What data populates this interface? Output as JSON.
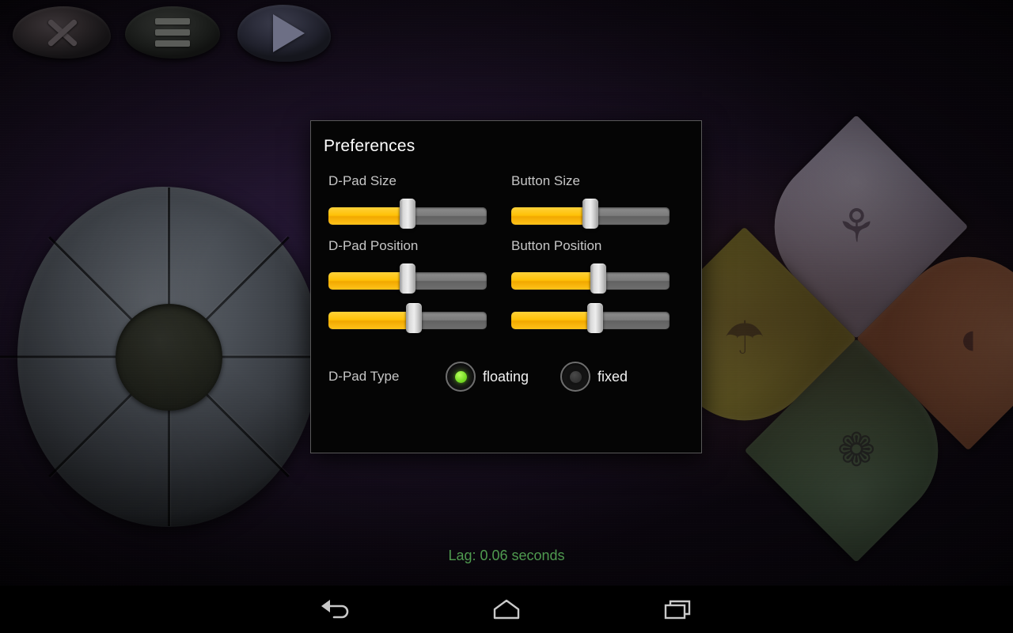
{
  "app": {
    "background_color": "#1c1126",
    "accent_color": "#ffc107",
    "selected_color": "#7bdf29"
  },
  "game_controls": {
    "close_button": {
      "icon": "close-x-icon",
      "label": "X"
    },
    "menu_button": {
      "icon": "hamburger-menu-icon",
      "label": "Menu"
    },
    "play_button": {
      "icon": "play-triangle-icon",
      "label": "Play"
    }
  },
  "game_art": {
    "dpad": {
      "name": "clay-dpad-flower",
      "petals": 8
    },
    "button_wheel": {
      "name": "clay-button-wheel",
      "wedges": [
        {
          "position": "top",
          "color": "#b9aec6",
          "glyph": "⚘"
        },
        {
          "position": "right",
          "color": "#c4714c",
          "glyph": "◖"
        },
        {
          "position": "bottom",
          "color": "#5f7a5c",
          "glyph": "❁"
        },
        {
          "position": "left",
          "color": "#b0a83a",
          "glyph": "☂"
        }
      ]
    }
  },
  "dialog": {
    "title": "Preferences",
    "fields": [
      {
        "label": "D-Pad Size",
        "name": "dpad-size",
        "sliders": [
          {
            "name": "dpad-size-slider",
            "value": 50
          }
        ]
      },
      {
        "label": "Button Size",
        "name": "button-size",
        "sliders": [
          {
            "name": "button-size-slider",
            "value": 50
          }
        ]
      },
      {
        "label": "D-Pad Position",
        "name": "dpad-position",
        "sliders": [
          {
            "name": "dpad-position-x-slider",
            "value": 50
          },
          {
            "name": "dpad-position-y-slider",
            "value": 54
          }
        ]
      },
      {
        "label": "Button Position",
        "name": "button-position",
        "sliders": [
          {
            "name": "button-position-x-slider",
            "value": 55
          },
          {
            "name": "button-position-y-slider",
            "value": 53
          }
        ]
      }
    ],
    "dpad_type": {
      "label": "D-Pad Type",
      "options": [
        {
          "label": "floating",
          "value": "floating",
          "selected": true
        },
        {
          "label": "fixed",
          "value": "fixed",
          "selected": false
        }
      ]
    }
  },
  "status": {
    "lag": "Lag: 0.06 seconds"
  },
  "nav_bar": {
    "back": {
      "icon": "back-arrow-icon",
      "label": "Back"
    },
    "home": {
      "icon": "home-icon",
      "label": "Home"
    },
    "recents": {
      "icon": "recent-apps-icon",
      "label": "Recent apps"
    }
  }
}
